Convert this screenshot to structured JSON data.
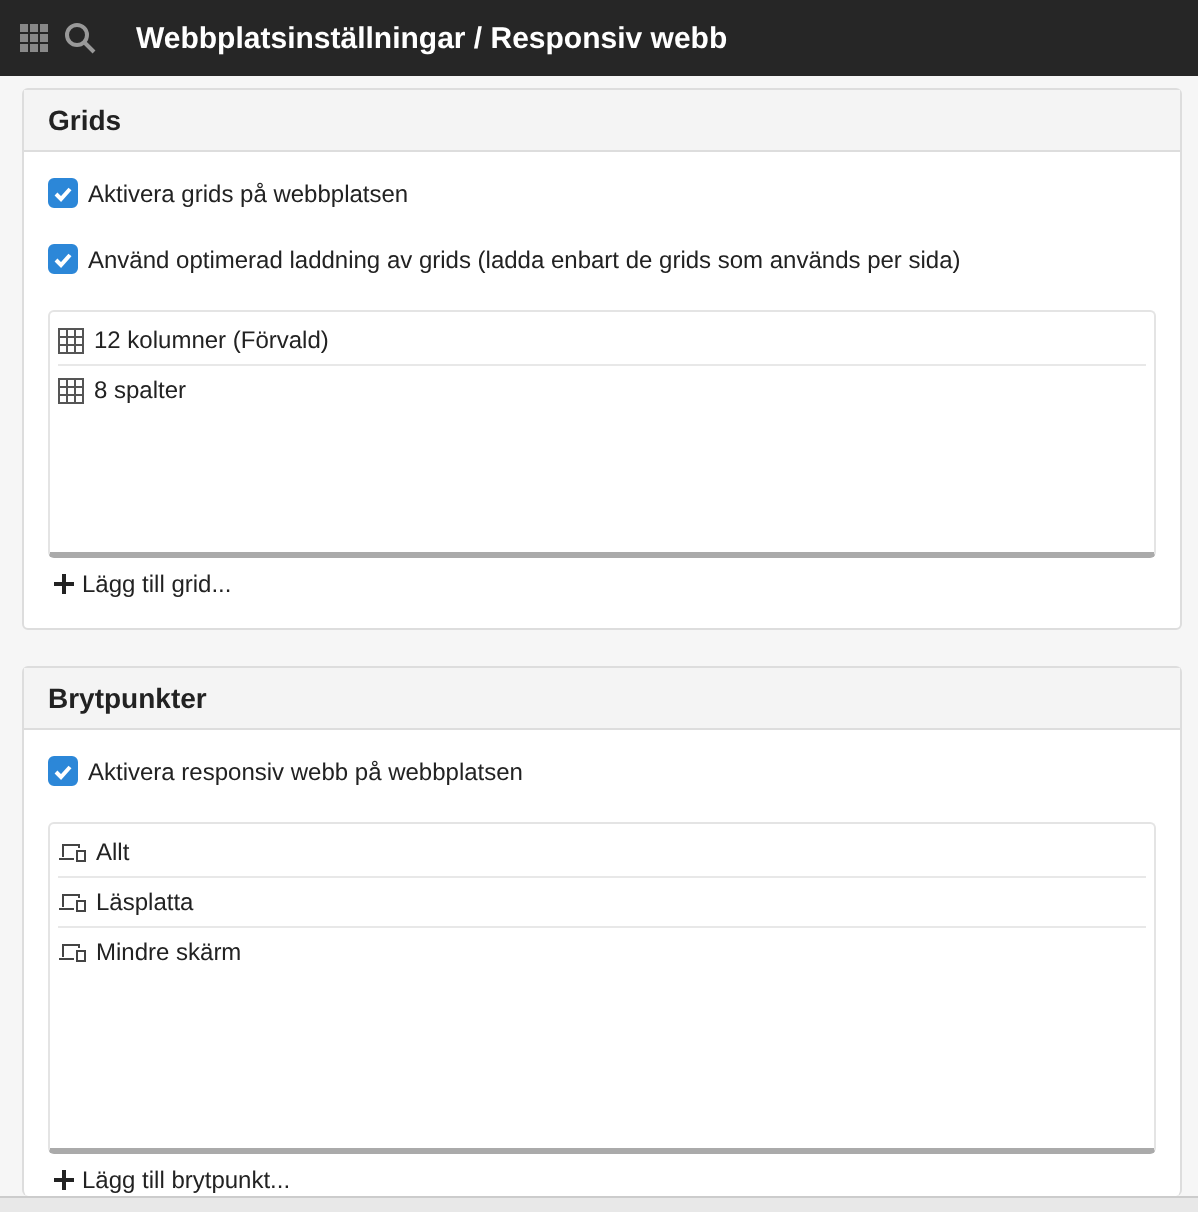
{
  "topbar": {
    "title": "Webbplatsinställningar / Responsiv webb"
  },
  "panels": [
    {
      "title": "Grids",
      "checkboxes": [
        {
          "label": "Aktivera grids på webbplatsen",
          "checked": true
        },
        {
          "label": "Använd optimerad laddning av grids (ladda enbart de grids som används per sida)",
          "checked": true
        }
      ],
      "items": [
        {
          "kind": "grid",
          "label": "12 kolumner (Förvald)"
        },
        {
          "kind": "grid",
          "label": "8 spalter"
        }
      ],
      "add_link": "Lägg till grid..."
    },
    {
      "title": "Brytpunkter",
      "checkboxes": [
        {
          "label": "Aktivera responsiv webb på webbplatsen",
          "checked": true
        }
      ],
      "items": [
        {
          "kind": "device",
          "label": "Allt"
        },
        {
          "kind": "device",
          "label": "Läsplatta"
        },
        {
          "kind": "device",
          "label": "Mindre skärm"
        }
      ],
      "add_link": "Lägg till brytpunkt..."
    }
  ]
}
